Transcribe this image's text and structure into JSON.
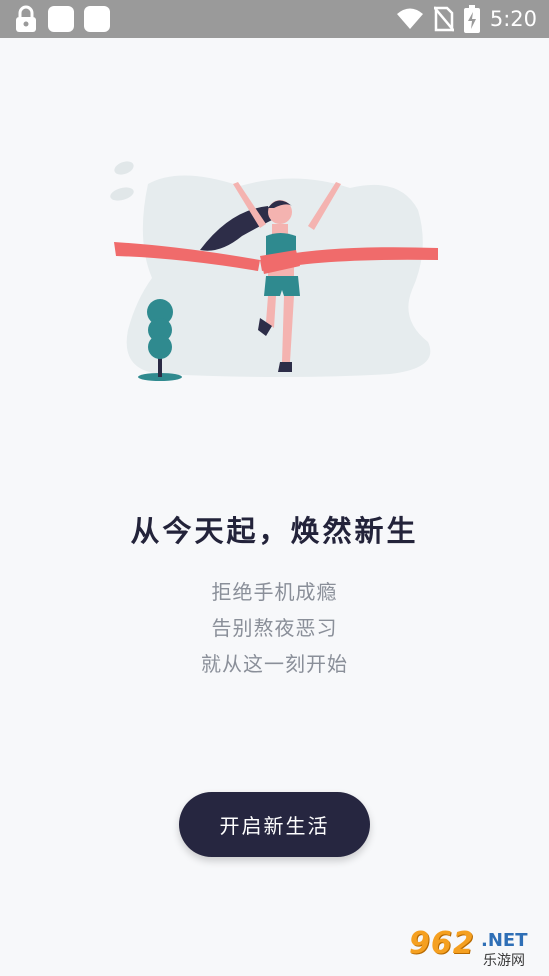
{
  "status_bar": {
    "time": "5:20",
    "icons": [
      "lock-icon",
      "notification-square-icon",
      "notification-square-icon",
      "wifi-icon",
      "no-sim-icon",
      "battery-charging-icon"
    ]
  },
  "content": {
    "headline": "从今天起，焕然新生",
    "lines": [
      "拒绝手机成瘾",
      "告别熬夜恶习",
      "就从这一刻开始"
    ],
    "cta_label": "开启新生活"
  },
  "watermark": {
    "number": "962",
    "suffix": ".NET",
    "cn": "乐游网"
  },
  "colors": {
    "background": "#f7f8fa",
    "status_bar": "#9a9a9a",
    "headline": "#23233a",
    "subtext": "#8a8f99",
    "button": "#262640",
    "ribbon": "#f06b6b",
    "teal": "#2f8a8f"
  }
}
